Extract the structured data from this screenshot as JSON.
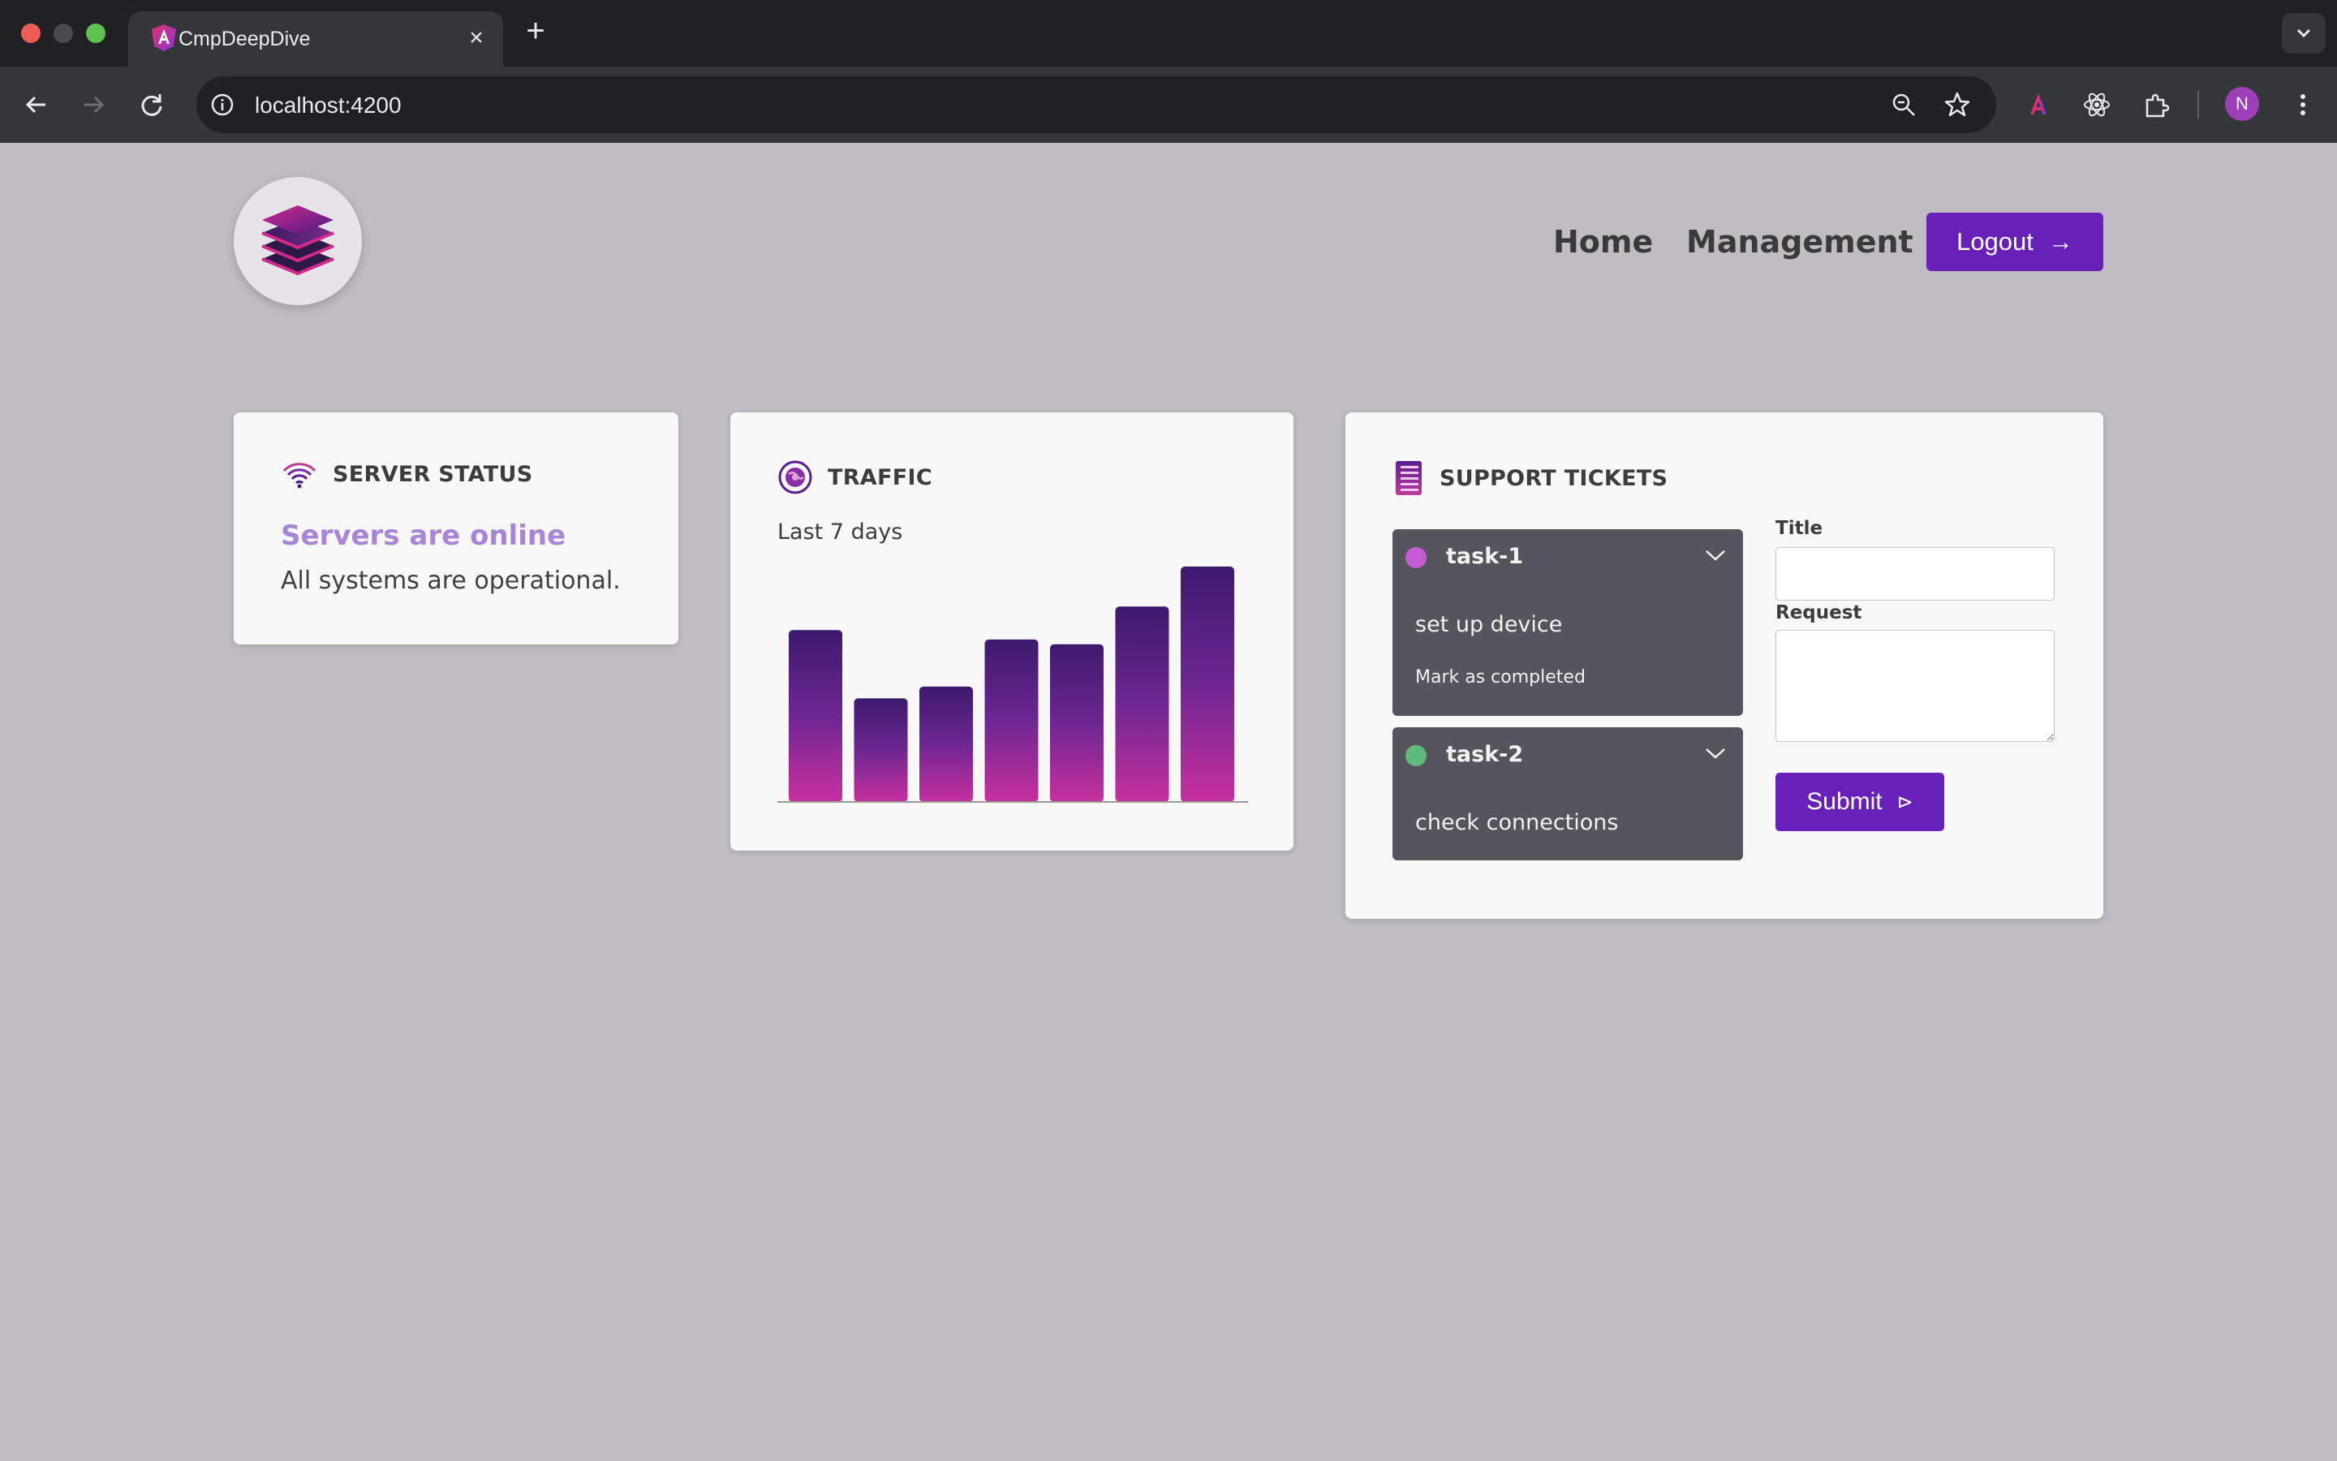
{
  "browser": {
    "tab_title": "CmpDeepDive",
    "tab_close": "×",
    "new_tab": "+",
    "url": "localhost:4200",
    "avatar_letter": "N"
  },
  "header": {
    "nav": [
      {
        "label": "Home"
      },
      {
        "label": "Management"
      }
    ],
    "logout_label": "Logout",
    "logout_arrow": "→"
  },
  "server_status": {
    "title": "SERVER STATUS",
    "status_heading": "Servers are online",
    "status_text": "All systems are operational."
  },
  "traffic": {
    "title": "TRAFFIC",
    "subtitle": "Last 7 days"
  },
  "chart_data": {
    "type": "bar",
    "title": "TRAFFIC",
    "subtitle": "Last 7 days",
    "categories": [
      "",
      "",
      "",
      "",
      "",
      "",
      ""
    ],
    "values": [
      73,
      44,
      49,
      69,
      67,
      83,
      100
    ],
    "ylim": [
      0,
      100
    ],
    "grid": false,
    "colors": {
      "bar_top": "#3d1a6e",
      "bar_bottom": "#c7309e"
    }
  },
  "support": {
    "title": "SUPPORT TICKETS",
    "tickets": [
      {
        "title": "task-1",
        "body": "set up device",
        "action": "Mark as completed",
        "dot_color": "#c65bd6"
      },
      {
        "title": "task-2",
        "body": "check connections",
        "dot_color": "#5fba7d"
      }
    ],
    "form": {
      "title_label": "Title",
      "title_value": "",
      "request_label": "Request",
      "request_value": "",
      "submit_label": "Submit",
      "submit_icon": "⊳"
    }
  },
  "colors": {
    "accent": "#6721b8",
    "background": "#bfbcc4",
    "card": "#f8f8f8",
    "ticket_bg": "#56545d",
    "status_heading": "#a885d6"
  }
}
